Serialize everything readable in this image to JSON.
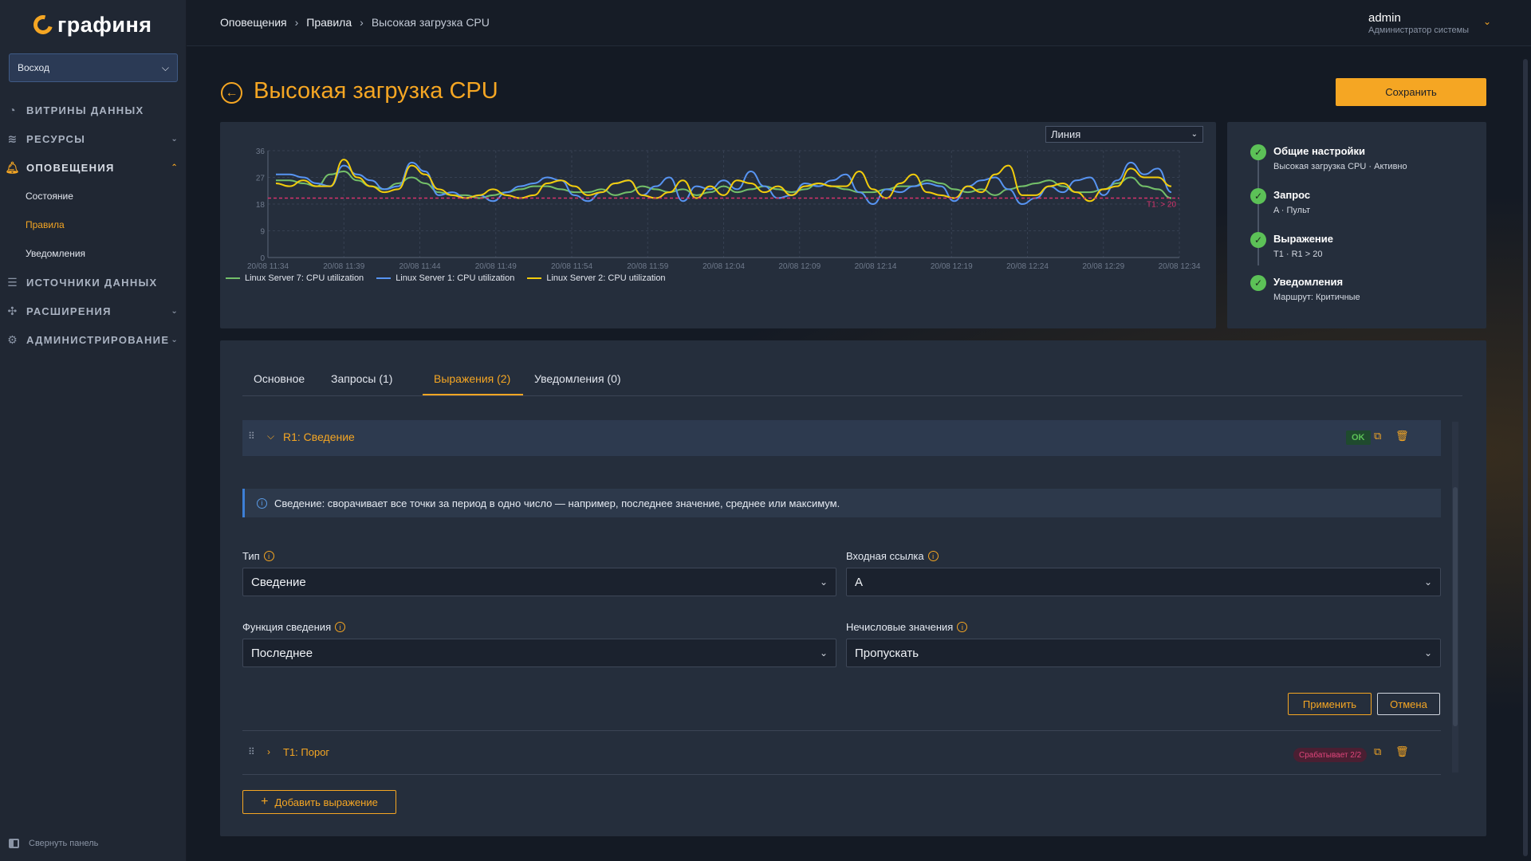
{
  "brand": {
    "name": "графиня"
  },
  "org_selector": {
    "value": "Восход"
  },
  "nav": {
    "items": [
      {
        "label": "ВИТРИНЫ ДАННЫХ",
        "icon": "gauge-icon"
      },
      {
        "label": "РЕСУРСЫ",
        "icon": "layers-icon"
      },
      {
        "label": "ОПОВЕЩЕНИЯ",
        "icon": "bell-icon"
      },
      {
        "label": "ИСТОЧНИКИ ДАННЫХ",
        "icon": "database-icon"
      },
      {
        "label": "РАСШИРЕНИЯ",
        "icon": "puzzle-icon"
      },
      {
        "label": "АДМИНИСТРИРОВАНИЕ",
        "icon": "gear-icon"
      }
    ],
    "alert_sub": [
      "Состояние",
      "Правила",
      "Уведомления"
    ],
    "collapse_label": "Свернуть панель"
  },
  "breadcrumb": {
    "items": [
      "Оповещения",
      "Правила"
    ],
    "current": "Высокая загрузка CPU"
  },
  "user": {
    "name": "admin",
    "role": "Администратор системы"
  },
  "page": {
    "title": "Высокая загрузка CPU",
    "save_label": "Сохранить"
  },
  "chart": {
    "viz_type": "Линия"
  },
  "chart_data": {
    "type": "line",
    "title": "",
    "ylim": [
      0,
      36
    ],
    "yticks": [
      "36",
      "27",
      "18",
      "9",
      "0"
    ],
    "xticks": [
      "20/08 11:34",
      "20/08 11:39",
      "20/08 11:44",
      "20/08 11:49",
      "20/08 11:54",
      "20/08 11:59",
      "20/08 12:04",
      "20/08 12:09",
      "20/08 12:14",
      "20/08 12:19",
      "20/08 12:24",
      "20/08 12:29",
      "20/08 12:34"
    ],
    "threshold": {
      "value": 20,
      "label": "T1: > 20",
      "color": "#d6336c"
    },
    "series": [
      {
        "name": "Linux Server 7: CPU utilization",
        "color": "#73bf69",
        "values": [
          26,
          26,
          25,
          24,
          28,
          29,
          26,
          24,
          23,
          25,
          27,
          25,
          22,
          21,
          21,
          20,
          21,
          22,
          23,
          24,
          24,
          23,
          22,
          22,
          23,
          21,
          22,
          24,
          23,
          22,
          23,
          21,
          22,
          24,
          22,
          23,
          24,
          23,
          22,
          23,
          25,
          24,
          23,
          22,
          22,
          23,
          24,
          24,
          26,
          25,
          23,
          22,
          23,
          21,
          23,
          24,
          25,
          26,
          24,
          22,
          22,
          23,
          25,
          27,
          24,
          23,
          20
        ]
      },
      {
        "name": "Linux Server 1: CPU utilization",
        "color": "#5794f2",
        "values": [
          28,
          28,
          27,
          25,
          24,
          31,
          28,
          26,
          23,
          24,
          32,
          29,
          21,
          22,
          20,
          21,
          19,
          22,
          24,
          25,
          27,
          26,
          21,
          19,
          22,
          25,
          26,
          21,
          24,
          27,
          19,
          24,
          23,
          26,
          23,
          29,
          24,
          20,
          21,
          25,
          24,
          26,
          28,
          22,
          18,
          23,
          22,
          24,
          25,
          24,
          19,
          24,
          26,
          27,
          23,
          18,
          20,
          24,
          22,
          26,
          27,
          21,
          26,
          32,
          28,
          30,
          22
        ]
      },
      {
        "name": "Linux Server 2: CPU utilization",
        "color": "#f2cc0c",
        "values": [
          25,
          24,
          26,
          24,
          24,
          33,
          27,
          24,
          22,
          23,
          31,
          28,
          23,
          21,
          20,
          21,
          23,
          21,
          20,
          21,
          25,
          26,
          24,
          21,
          22,
          25,
          26,
          21,
          20,
          22,
          26,
          20,
          24,
          21,
          26,
          25,
          22,
          24,
          21,
          24,
          25,
          24,
          24,
          29,
          23,
          20,
          25,
          28,
          22,
          21,
          20,
          24,
          22,
          28,
          31,
          21,
          21,
          24,
          25,
          22,
          19,
          23,
          24,
          30,
          27,
          27,
          24
        ]
      }
    ]
  },
  "steps": [
    {
      "title": "Общие настройки",
      "subtitle": "Высокая загрузка CPU · Активно"
    },
    {
      "title": "Запрос",
      "subtitle": "A · Пульт"
    },
    {
      "title": "Выражение",
      "subtitle": "T1 · R1 > 20"
    },
    {
      "title": "Уведомления",
      "subtitle": "Маршрут: Критичные"
    }
  ],
  "tabs": [
    "Основное",
    "Запросы (1)",
    "Выражения (2)",
    "Уведомления (0)"
  ],
  "expressions": [
    {
      "name": "R1: Сведение",
      "badge": "OK",
      "badge_color": "#5cc157"
    },
    {
      "name": "T1: Порог",
      "badge": "Срабатывает 2/2",
      "badge_color": "#e0457b"
    }
  ],
  "info_text": "Сведение: сворачивает все точки за период в одно число — например, последнее значение, среднее или максимум.",
  "form": {
    "type": {
      "label": "Тип",
      "value": "Сведение"
    },
    "input_ref": {
      "label": "Входная ссылка",
      "value": "A"
    },
    "reduce_fn": {
      "label": "Функция сведения",
      "value": "Последнее"
    },
    "non_numeric": {
      "label": "Нечисловые значения",
      "value": "Пропускать"
    }
  },
  "buttons": {
    "apply": "Применить",
    "cancel": "Отмена",
    "add_expression": "Добавить выражение"
  }
}
